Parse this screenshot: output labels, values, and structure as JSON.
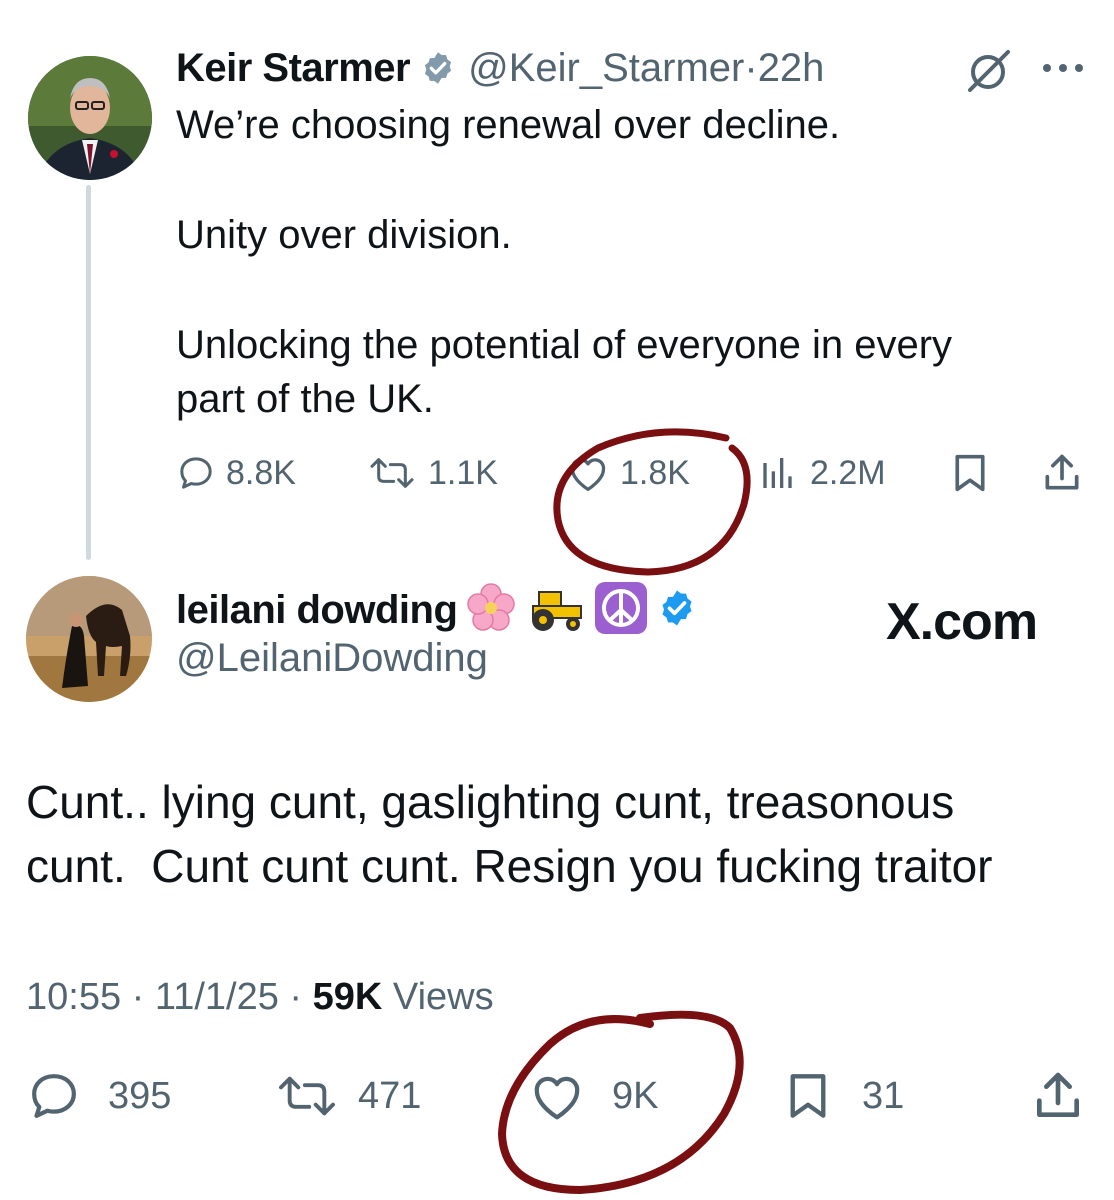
{
  "tweet1": {
    "author_name": "Keir Starmer",
    "handle": "@Keir_Starmer",
    "separator": "·",
    "time": "22h",
    "text_lines": [
      "We’re choosing renewal over decline.",
      "Unity over division.",
      "Unlocking the potential of everyone in every",
      "part of the UK."
    ],
    "actions": {
      "replies": "8.8K",
      "reposts": "1.1K",
      "likes": "1.8K",
      "views": "2.2M"
    }
  },
  "tweet2": {
    "author_name": "leilani dowding",
    "name_emojis": [
      "🌸",
      "🚜",
      "☮️"
    ],
    "handle": "@LeilaniDowding",
    "text_lines": [
      "Cunt.. lying cunt, gaslighting cunt, treasonous",
      "cunt.  Cunt cunt cunt. Resign you fucking traitor"
    ],
    "meta": {
      "time": "10:55",
      "date": "11/1/25",
      "sep": "·",
      "views_count": "59K",
      "views_label": "Views"
    },
    "actions": {
      "replies": "395",
      "reposts": "471",
      "likes": "9K",
      "bookmarks": "31"
    }
  },
  "watermark": "X.com",
  "colors": {
    "verified_blue": "#1d9bf0",
    "annotation_red": "#7a0f12",
    "muted_text": "#536471"
  },
  "icons": [
    "grok-icon",
    "more-icon",
    "reply-icon",
    "repost-icon",
    "like-icon",
    "views-icon",
    "bookmark-icon",
    "share-icon",
    "verified-badge-icon"
  ]
}
